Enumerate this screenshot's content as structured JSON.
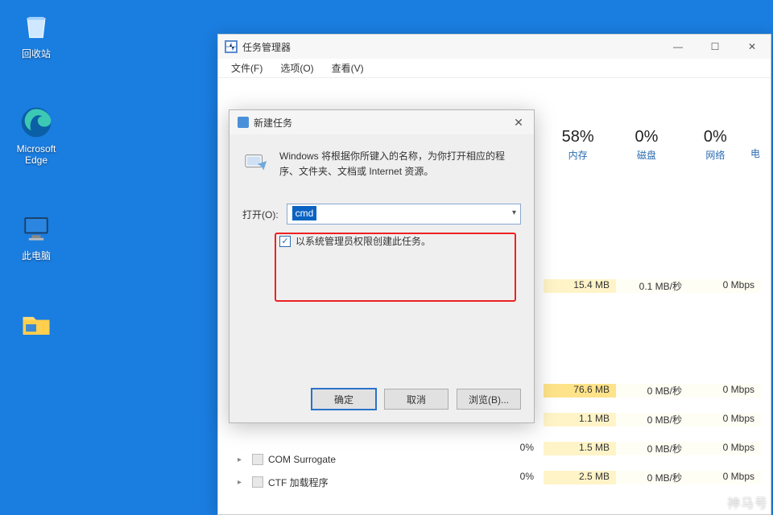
{
  "desktop": {
    "icons": [
      {
        "name": "recycle-bin",
        "label": "回收站"
      },
      {
        "name": "edge",
        "label": "Microsoft Edge"
      },
      {
        "name": "this-pc",
        "label": "此电脑"
      },
      {
        "name": "file-explorer",
        "label": ""
      }
    ]
  },
  "taskmgr": {
    "title": "任务管理器",
    "menus": {
      "file": "文件(F)",
      "options": "选项(O)",
      "view": "查看(V)"
    },
    "columns": {
      "memory": {
        "pct": "58%",
        "label": "内存"
      },
      "disk": {
        "pct": "0%",
        "label": "磁盘"
      },
      "network": {
        "pct": "0%",
        "label": "网络"
      },
      "extra": "电"
    },
    "rows": [
      {
        "cpu": "",
        "mem": "15.4 MB",
        "mem_hi": false,
        "disk": "0.1 MB/秒",
        "net": "0 Mbps"
      },
      {
        "cpu": "",
        "mem": "76.6 MB",
        "mem_hi": true,
        "disk": "0 MB/秒",
        "net": "0 Mbps"
      },
      {
        "cpu": "",
        "mem": "1.1 MB",
        "mem_hi": false,
        "disk": "0 MB/秒",
        "net": "0 Mbps"
      },
      {
        "cpu": "0%",
        "mem": "1.5 MB",
        "mem_hi": false,
        "disk": "0 MB/秒",
        "net": "0 Mbps"
      },
      {
        "cpu": "0%",
        "mem": "2.5 MB",
        "mem_hi": false,
        "disk": "0 MB/秒",
        "net": "0 Mbps"
      }
    ],
    "processes": [
      {
        "name": "COM Surrogate"
      },
      {
        "name": "CTF 加载程序"
      }
    ]
  },
  "run": {
    "title": "新建任务",
    "description": "Windows 将根据你所键入的名称，为你打开相应的程序、文件夹、文档或 Internet 资源。",
    "open_label": "打开(O):",
    "open_value": "cmd",
    "admin_label": "以系统管理员权限创建此任务。",
    "buttons": {
      "ok": "确定",
      "cancel": "取消",
      "browse": "浏览(B)..."
    }
  },
  "watermark": "神马号"
}
